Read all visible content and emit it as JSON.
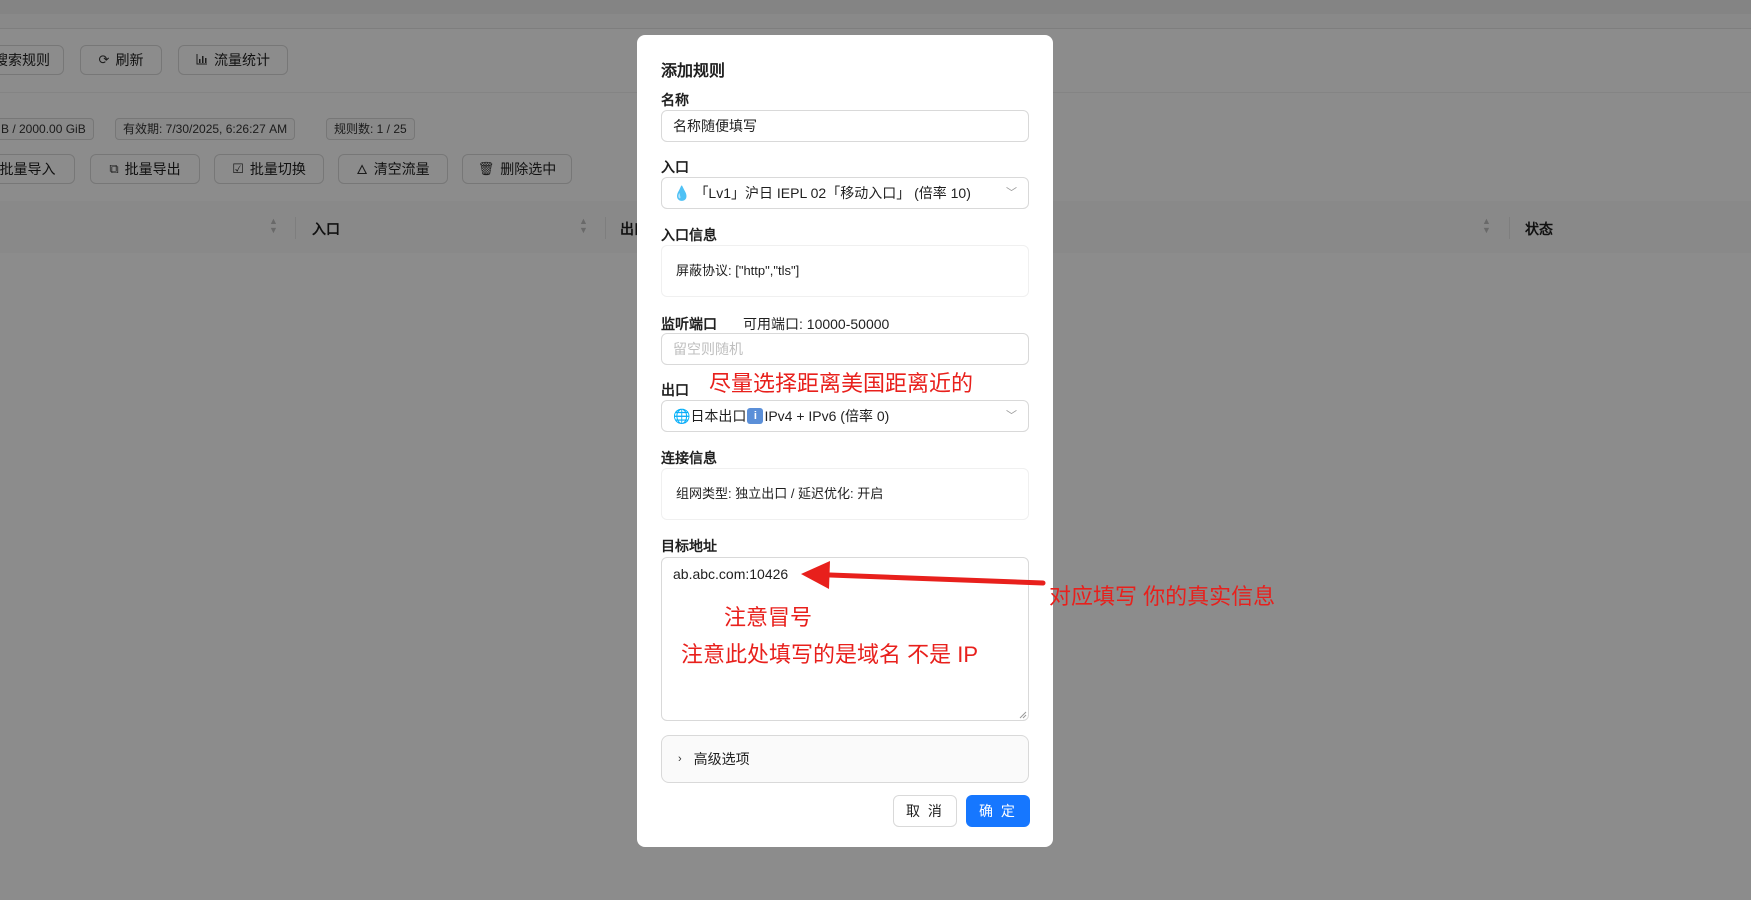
{
  "background": {
    "toolbar": [
      {
        "label": "搜索规则",
        "icon": "search-icon"
      },
      {
        "label": "刷新",
        "icon": "refresh-icon"
      },
      {
        "label": "流量统计",
        "icon": "bar-chart-icon"
      }
    ],
    "tags": {
      "traffic": "B / 2000.00 GiB",
      "expiry": "有效期: 7/30/2025, 6:26:27 AM",
      "rule_count": "规则数: 1 / 25"
    },
    "actions": [
      {
        "label": "批量导入"
      },
      {
        "label": "批量导出",
        "icon": "copy-icon"
      },
      {
        "label": "批量切换",
        "icon": "checkbox-icon"
      },
      {
        "label": "清空流量",
        "icon": "fire-icon"
      },
      {
        "label": "删除选中",
        "icon": "trash-icon"
      }
    ],
    "table_headers": {
      "entry": "入口",
      "exit": "出口",
      "status": "状态"
    }
  },
  "modal": {
    "title": "添加规则",
    "name_label": "名称",
    "name_value": "名称随便填写",
    "entry_label": "入口",
    "entry_value": "「Lv1」沪日 IEPL 02「移动入口」 (倍率 10)",
    "entry_info_label": "入口信息",
    "entry_info_value": "屏蔽协议: [\"http\",\"tls\"]",
    "port_label": "监听端口",
    "port_hint": "可用端口: 10000-50000",
    "port_placeholder": "留空则随机",
    "exit_label": "出口",
    "exit_value": "日本出口",
    "exit_value_suffix": "IPv4 + IPv6 (倍率 0)",
    "conn_info_label": "连接信息",
    "conn_info_value": "组网类型: 独立出口 / 延迟优化: 开启",
    "target_label": "目标地址",
    "target_value": "ab.abc.com:10426",
    "advanced_label": "高级选项",
    "cancel_label": "取 消",
    "ok_label": "确 定"
  },
  "annotations": {
    "exit_hint": "尽量选择距离美国距离近的",
    "fill_hint": "对应填写 你的真实信息",
    "colon_hint": "注意冒号",
    "domain_hint": "注意此处填写的是域名 不是 IP",
    "color": "#e8201c"
  },
  "colors": {
    "primary": "#1677ff",
    "mask": "rgba(0,0,0,0.45)"
  }
}
